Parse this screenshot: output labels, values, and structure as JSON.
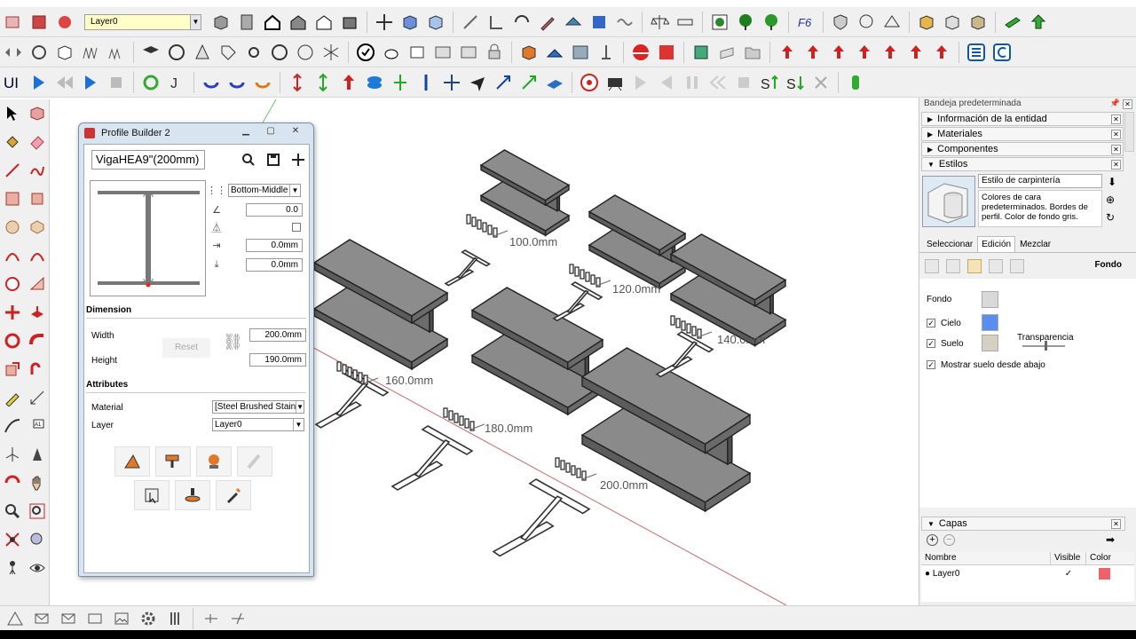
{
  "toolbar": {
    "layer_selector": {
      "value": "Layer0"
    }
  },
  "dialog": {
    "title": "Profile Builder 2",
    "profile_name": "VigaHEA9\"(200mm)",
    "anchor": "Bottom-Middle",
    "rotation": "0.0",
    "offset_x": "0.0mm",
    "offset_y": "0.0mm",
    "dimension_label": "Dimension",
    "width_label": "Width",
    "width_value": "200.0mm",
    "height_label": "Height",
    "height_value": "190.0mm",
    "reset_label": "Reset",
    "attributes_label": "Attributes",
    "material_label": "Material",
    "material_value": "[Steel Brushed Stain",
    "layer_label": "Layer",
    "layer_value": "Layer0"
  },
  "viewport": {
    "dimensions": [
      "100.0mm",
      "120.0mm",
      "140.0mm",
      "160.0mm",
      "180.0mm",
      "200.0mm"
    ]
  },
  "tray": {
    "title": "Bandeja predeterminada",
    "panels": [
      "Información de la entidad",
      "Materiales",
      "Componentes",
      "Estilos"
    ],
    "style_name": "Estilo de carpintería",
    "style_description": "Colores de cara predeterminados. Bordes de perfil. Color de fondo gris.",
    "tabs": [
      "Seleccionar",
      "Edición",
      "Mezclar"
    ],
    "section_title": "Fondo",
    "fondo_label": "Fondo",
    "cielo_label": "Cielo",
    "suelo_label": "Suelo",
    "transparencia_label": "Transparencia",
    "mostrar_label": "Mostrar suelo desde abajo",
    "colors": {
      "fondo": "#d9d9d9",
      "cielo": "#5b8cf0",
      "suelo": "#d6d0c2"
    },
    "layers": {
      "title": "Capas",
      "col_name": "Nombre",
      "col_visible": "Visible",
      "col_color": "Color",
      "rows": [
        {
          "name": "Layer0",
          "visible": "✓",
          "color": "#f0626b"
        }
      ]
    }
  }
}
